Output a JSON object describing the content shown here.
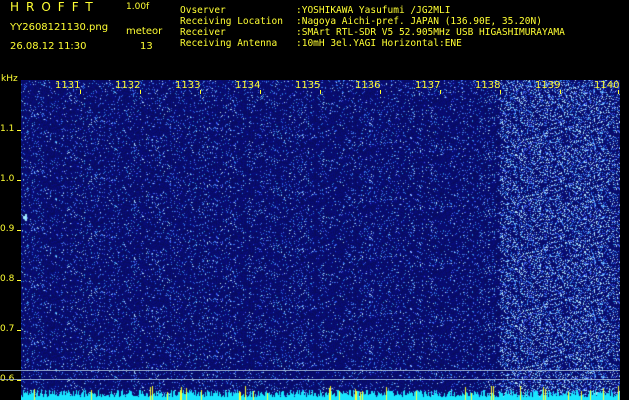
{
  "header": {
    "logo": "HROFFT",
    "version": "1.00f",
    "filename": "YY2608121130.png",
    "meteor_label": "meteor",
    "datetime": "26.08.12 11:30",
    "meteor_count": "13"
  },
  "info": [
    {
      "key": "Ovserver",
      "value": ":YOSHIKAWA Yasufumi /JG2MLI"
    },
    {
      "key": "Receiving Location",
      "value": ":Nagoya Aichi-pref. JAPAN (136.90E, 35.20N)"
    },
    {
      "key": "Receiver",
      "value": ":SMArt RTL-SDR V5 52.905MHz USB HIGASHIMURAYAMA"
    },
    {
      "key": "Receiving Antenna",
      "value": ":10mH 3el.YAGI Horizontal:ENE"
    }
  ],
  "axis": {
    "y_unit": "kHz",
    "y_ticks": [
      "1.1",
      "1.0",
      "0.9",
      "0.8",
      "0.7",
      "0.6"
    ],
    "x_ticks": [
      "1131",
      "1132",
      "1133",
      "1134",
      "1135",
      "1136",
      "1137",
      "1138",
      "1139",
      "1140"
    ]
  },
  "colors": {
    "background": "#000000",
    "text": "#ffff33",
    "spectrum_base": "#0a0f6e",
    "noise_band": "#19e6ff"
  }
}
